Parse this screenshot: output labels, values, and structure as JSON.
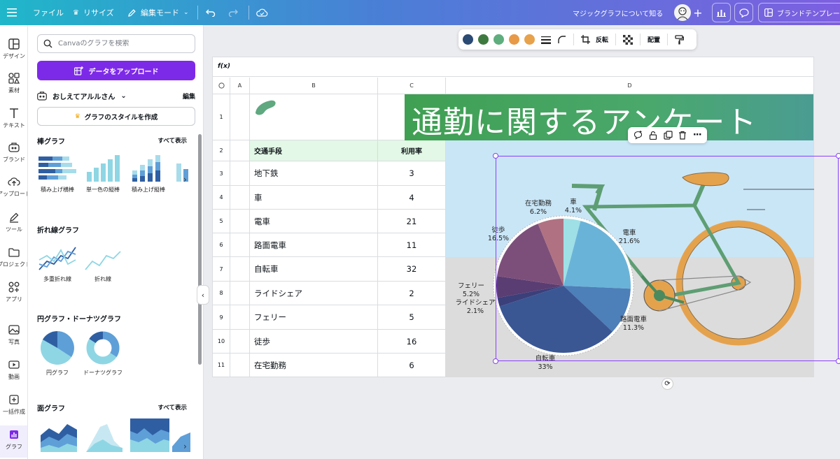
{
  "topbar": {
    "menu_icon": "hamburger-icon",
    "file": "ファイル",
    "resize": "リサイズ",
    "edit_mode": "編集モード",
    "magic_chart": "マジックグラフについて知る",
    "brand_template": "ブランドテンプレー"
  },
  "rail": [
    {
      "label": "デザイン",
      "icon": "layout-icon"
    },
    {
      "label": "素材",
      "icon": "shapes-icon"
    },
    {
      "label": "テキスト",
      "icon": "text-icon"
    },
    {
      "label": "ブランド",
      "icon": "brand-icon"
    },
    {
      "label": "アップロード",
      "icon": "upload-icon"
    },
    {
      "label": "ツール",
      "icon": "pen-icon"
    },
    {
      "label": "プロジェクト",
      "icon": "folder-icon"
    },
    {
      "label": "アプリ",
      "icon": "apps-icon"
    },
    {
      "label": "写真",
      "icon": "photo-icon"
    },
    {
      "label": "動画",
      "icon": "video-icon"
    },
    {
      "label": "一括作成",
      "icon": "bulk-icon"
    },
    {
      "label": "グラフ",
      "icon": "chart-icon"
    }
  ],
  "panel": {
    "search_placeholder": "Canvaのグラフを検索",
    "upload_label": "データをアップロード",
    "brand_name": "おしえてアルルさん",
    "edit_label": "編集",
    "style_label": "グラフのスタイルを作成",
    "bar": {
      "title": "棒グラフ",
      "see_all": "すべて表示",
      "items": [
        "積み上げ横棒",
        "単一色の縦棒",
        "積み上げ縦棒"
      ]
    },
    "line": {
      "title": "折れ線グラフ",
      "items": [
        "多重折れ線",
        "折れ線"
      ]
    },
    "pie": {
      "title": "円グラフ・ドーナツグラフ",
      "items": [
        "円グラフ",
        "ドーナツグラフ"
      ]
    },
    "area": {
      "title": "面グラフ",
      "see_all": "すべて表示"
    }
  },
  "toolbar": {
    "colors": [
      "#2b4a74",
      "#3e7a3f",
      "#5fae7e",
      "#e89a46",
      "#e8a24c"
    ],
    "flip": "反転",
    "arrange": "配置"
  },
  "sheet": {
    "fx": "f(x)",
    "columns": [
      "A",
      "B",
      "C",
      "D"
    ],
    "rows": [
      {
        "n": "1",
        "label": "",
        "value": ""
      },
      {
        "n": "2",
        "label": "交通手段",
        "value": "利用率"
      },
      {
        "n": "3",
        "label": "地下鉄",
        "value": "3"
      },
      {
        "n": "4",
        "label": "車",
        "value": "4"
      },
      {
        "n": "5",
        "label": "電車",
        "value": "21"
      },
      {
        "n": "6",
        "label": "路面電車",
        "value": "11"
      },
      {
        "n": "7",
        "label": "自転車",
        "value": "32"
      },
      {
        "n": "8",
        "label": "ライドシェア",
        "value": "2"
      },
      {
        "n": "9",
        "label": "フェリー",
        "value": "5"
      },
      {
        "n": "10",
        "label": "徒歩",
        "value": "16"
      },
      {
        "n": "11",
        "label": "在宅勤務",
        "value": "6"
      }
    ],
    "banner_title": "通勤に関するアンケート"
  },
  "chart_data": {
    "type": "pie",
    "title": "",
    "slices": [
      {
        "label": "車",
        "pct": "4.1%",
        "value": 4.1,
        "color": "#9ee0e6"
      },
      {
        "label": "電車",
        "pct": "21.6%",
        "value": 21.6,
        "color": "#6ab3d8"
      },
      {
        "label": "路面電車",
        "pct": "11.3%",
        "value": 11.3,
        "color": "#4d7fb8"
      },
      {
        "label": "自転車",
        "pct": "33%",
        "value": 33,
        "color": "#3a5794"
      },
      {
        "label": "ライドシェア",
        "pct": "2.1%",
        "value": 2.1,
        "color": "#3b3f7a"
      },
      {
        "label": "フェリー",
        "pct": "5.2%",
        "value": 5.2,
        "color": "#5a3d72"
      },
      {
        "label": "徒歩",
        "pct": "16.5%",
        "value": 16.5,
        "color": "#7c4f7a"
      },
      {
        "label": "在宅勤務",
        "pct": "6.2%",
        "value": 6.2,
        "color": "#b07282"
      }
    ]
  }
}
